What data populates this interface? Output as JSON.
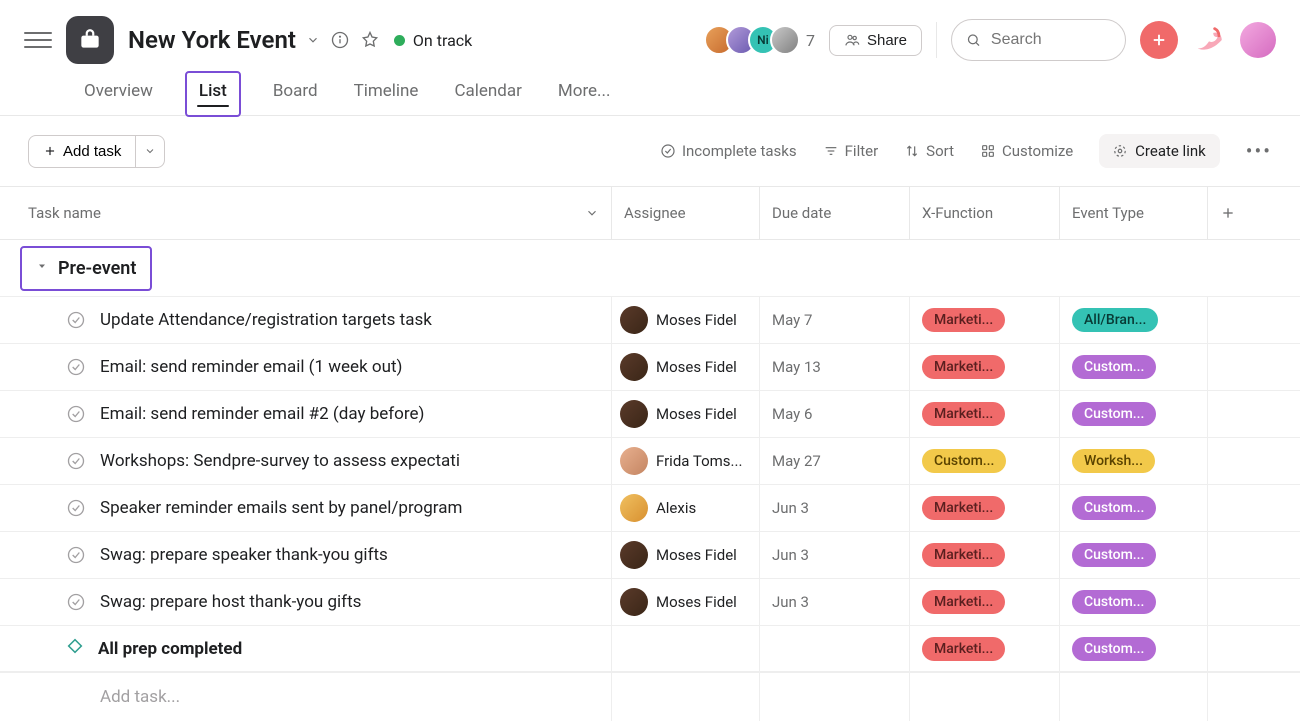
{
  "header": {
    "project_title": "New York Event",
    "status_label": "On track",
    "collaborator_initials": "Ni",
    "collaborator_count": "7",
    "share_label": "Share",
    "search_placeholder": "Search"
  },
  "tabs": {
    "overview": "Overview",
    "list": "List",
    "board": "Board",
    "timeline": "Timeline",
    "calendar": "Calendar",
    "more": "More..."
  },
  "toolbar": {
    "add_task": "Add task",
    "incomplete": "Incomplete tasks",
    "filter": "Filter",
    "sort": "Sort",
    "customize": "Customize",
    "create_link": "Create link"
  },
  "columns": {
    "task_name": "Task name",
    "assignee": "Assignee",
    "due_date": "Due date",
    "xfunction": "X-Function",
    "event_type": "Event Type"
  },
  "section": {
    "title": "Pre-event"
  },
  "palette": {
    "marketing": {
      "bg": "#f06a6a",
      "fg": "#5a1f1f",
      "label": "Marketi..."
    },
    "customer_success_yellow": {
      "bg": "#f2c94a",
      "fg": "#5a4300",
      "label": "Custom..."
    },
    "all_brand": {
      "bg": "#34c2b4",
      "fg": "#083a35",
      "label": "All/Bran..."
    },
    "customer_purple": {
      "bg": "#b36bd4",
      "fg": "#ffffff",
      "label": "Custom..."
    },
    "workshop": {
      "bg": "#f2c94a",
      "fg": "#5a4300",
      "label": "Worksh..."
    }
  },
  "tasks": [
    {
      "name": "Update Attendance/registration targets task",
      "assignee": "Moses Fidel",
      "avatar_class": "c5",
      "due": "May 7",
      "xfunc_key": "marketing",
      "etype_key": "all_brand",
      "milestone": false
    },
    {
      "name": "Email: send reminder email (1 week out)",
      "assignee": "Moses Fidel",
      "avatar_class": "c5",
      "due": "May 13",
      "xfunc_key": "marketing",
      "etype_key": "customer_purple",
      "milestone": false
    },
    {
      "name": "Email: send reminder email #2 (day before)",
      "assignee": "Moses Fidel",
      "avatar_class": "c5",
      "due": "May 6",
      "xfunc_key": "marketing",
      "etype_key": "customer_purple",
      "milestone": false
    },
    {
      "name": "Workshops: Sendpre-survey to assess expectati",
      "assignee": "Frida Toms...",
      "avatar_class": "c6",
      "due": "May 27",
      "xfunc_key": "customer_success_yellow",
      "etype_key": "workshop",
      "milestone": false
    },
    {
      "name": "Speaker reminder emails sent by panel/program",
      "assignee": "Alexis",
      "avatar_class": "c7",
      "due": "Jun 3",
      "xfunc_key": "marketing",
      "etype_key": "customer_purple",
      "milestone": false
    },
    {
      "name": "Swag: prepare speaker thank-you gifts",
      "assignee": "Moses Fidel",
      "avatar_class": "c5",
      "due": "Jun 3",
      "xfunc_key": "marketing",
      "etype_key": "customer_purple",
      "milestone": false
    },
    {
      "name": "Swag: prepare host thank-you gifts",
      "assignee": "Moses Fidel",
      "avatar_class": "c5",
      "due": "Jun 3",
      "xfunc_key": "marketing",
      "etype_key": "customer_purple",
      "milestone": false
    },
    {
      "name": "All prep completed",
      "assignee": "",
      "avatar_class": "",
      "due": "",
      "xfunc_key": "marketing",
      "etype_key": "customer_purple",
      "milestone": true
    }
  ],
  "add_task_placeholder": "Add task..."
}
